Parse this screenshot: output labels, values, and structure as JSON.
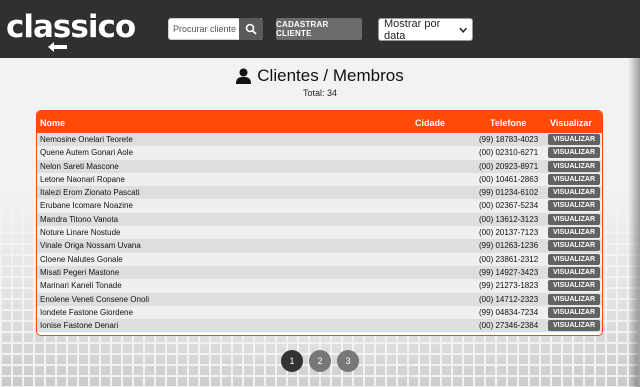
{
  "header": {
    "logo_text": "classico",
    "search_placeholder": "Procurar cliente",
    "add_button_label": "CADASTRAR CLIENTE",
    "sort_selected": "Mostrar por data"
  },
  "main": {
    "title": "Clientes / Membros",
    "total_text": "Total: 34",
    "columns": {
      "name": "Nome",
      "city": "Cidade",
      "phone": "Telefone",
      "view": "Visualizar"
    },
    "view_button_label": "VISUALIZAR",
    "rows": [
      {
        "name": "Nemosine Onelari Teorete",
        "phone": "(99) 18783-4023"
      },
      {
        "name": "Quene Autem Gonari Aole",
        "phone": "(00) 02310-6271"
      },
      {
        "name": "Nelon Sareti Mascone",
        "phone": "(00) 20923-8971"
      },
      {
        "name": "Letone Naonari Ropane",
        "phone": "(00) 10461-2863"
      },
      {
        "name": "Italezi Erom Zionato Pascati",
        "phone": "(99) 01234-6102"
      },
      {
        "name": "Erubane Icomare Noazine",
        "phone": "(00) 02367-5234"
      },
      {
        "name": "Mandra Titono Vanota",
        "phone": "(00) 13612-3123"
      },
      {
        "name": "Noture Linare Nostude",
        "phone": "(00) 20137-7123"
      },
      {
        "name": "Vinale Origa Nossam Uvana",
        "phone": "(99) 01263-1236"
      },
      {
        "name": "Cloene Nalutes Gonale",
        "phone": "(00) 23861-2312"
      },
      {
        "name": "Misati Pegeri Mastone",
        "phone": "(99) 14927-3423"
      },
      {
        "name": "Marinari Kaneli Tonade",
        "phone": "(99) 21273-1823"
      },
      {
        "name": "Enolene Veneti Consene Onoli",
        "phone": "(00) 14712-2323"
      },
      {
        "name": "Iondete Fastone Giordene",
        "phone": "(99) 04834-7234"
      },
      {
        "name": "Ionise Fastone Denari",
        "phone": "(00) 27346-2384"
      }
    ]
  },
  "pagination": {
    "pages": [
      "1",
      "2",
      "3"
    ],
    "active": "1"
  },
  "colors": {
    "accent": "#ff4a08",
    "header_bg": "#303030"
  },
  "icons": {
    "back": "arrow-left-icon",
    "search": "search-icon",
    "dropdown": "chevron-down-icon",
    "title": "user-icon"
  }
}
